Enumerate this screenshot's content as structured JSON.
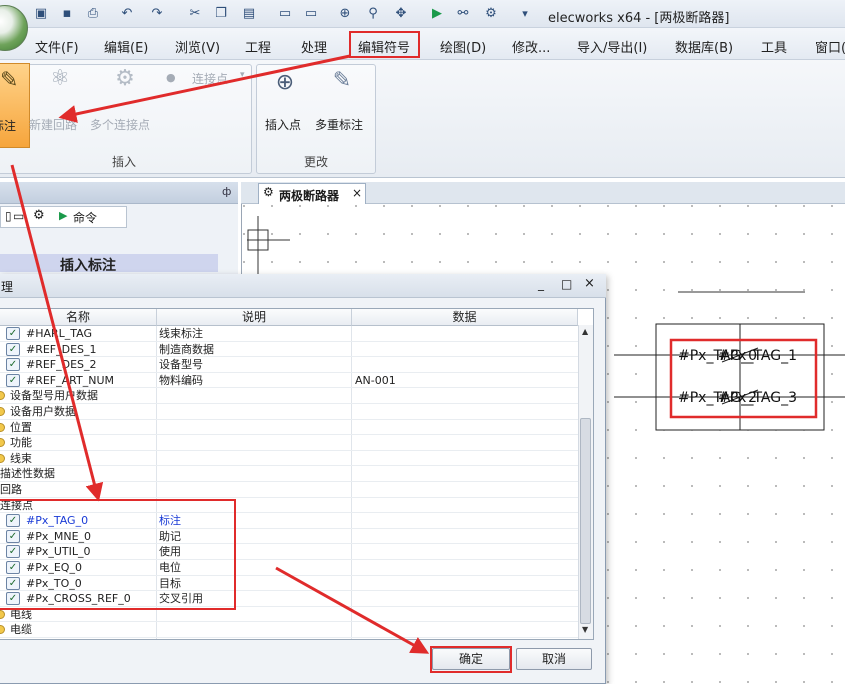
{
  "window": {
    "title": "elecworks x64 - [两极断路器]"
  },
  "menu": [
    "文件(F)",
    "编辑(E)",
    "浏览(V)",
    "工程",
    "处理",
    "编辑符号",
    "绘图(D)",
    "修改...",
    "导入/导出(I)",
    "数据库(B)",
    "工具",
    "窗口("
  ],
  "ribbon": {
    "insert_group": {
      "label": "插入",
      "buttons": [
        "标注",
        "新建回路",
        "多个连接点"
      ],
      "small_button": "连接点"
    },
    "change_group": {
      "label": "更改",
      "buttons": [
        "插入点",
        "多重标注"
      ]
    }
  },
  "left_panel": {
    "pin_glyph": "ф",
    "tab_label": "命令",
    "heading": "插入标注"
  },
  "document_tab": {
    "label": "两极断路器",
    "close": "×"
  },
  "canvas": {
    "symbol_lines": [
      "#Px_TAG_0",
      "#Px_TAG_2"
    ],
    "tag_overlays": [
      "#Px_TAG_1",
      "#Px_TAG_3"
    ]
  },
  "dialog": {
    "title": "理",
    "controls": [
      "_",
      "□",
      "×"
    ],
    "columns": [
      "名称",
      "说明",
      "数据"
    ],
    "rows": [
      {
        "name": "#HARL_TAG",
        "desc": "线束标注",
        "data": "",
        "icon": "check",
        "indent": 1
      },
      {
        "name": "#REF_DES_1",
        "desc": "制造商数据",
        "data": "",
        "icon": "check",
        "indent": 1
      },
      {
        "name": "#REF_DES_2",
        "desc": "设备型号",
        "data": "",
        "icon": "check",
        "indent": 1
      },
      {
        "name": "#REF_ART_NUM",
        "desc": "物料编码",
        "data": "AN-001",
        "icon": "check",
        "indent": 1
      },
      {
        "name": "设备型号用户数据",
        "desc": "",
        "data": "",
        "icon": "folder",
        "indent": 0
      },
      {
        "name": "设备用户数据",
        "desc": "",
        "data": "",
        "icon": "folder",
        "indent": 0
      },
      {
        "name": "位置",
        "desc": "",
        "data": "",
        "icon": "folder",
        "indent": 0
      },
      {
        "name": "功能",
        "desc": "",
        "data": "",
        "icon": "folder",
        "indent": 0
      },
      {
        "name": "线束",
        "desc": "",
        "data": "",
        "icon": "folder",
        "indent": 0
      },
      {
        "name": "描述性数据",
        "desc": "",
        "data": "",
        "icon": "none",
        "indent": 0
      },
      {
        "name": "回路",
        "desc": "",
        "data": "",
        "icon": "none",
        "indent": 0
      },
      {
        "name": "连接点",
        "desc": "",
        "data": "",
        "icon": "none",
        "indent": 0
      },
      {
        "name": "#Px_TAG_0",
        "desc": "标注",
        "data": "",
        "icon": "check",
        "indent": 1,
        "blue": true
      },
      {
        "name": "#Px_MNE_0",
        "desc": "助记",
        "data": "",
        "icon": "check",
        "indent": 1
      },
      {
        "name": "#Px_UTIL_0",
        "desc": "使用",
        "data": "",
        "icon": "check",
        "indent": 1
      },
      {
        "name": "#Px_EQ_0",
        "desc": "电位",
        "data": "",
        "icon": "check",
        "indent": 1
      },
      {
        "name": "#Px_TO_0",
        "desc": "目标",
        "data": "",
        "icon": "check",
        "indent": 1
      },
      {
        "name": "#Px_CROSS_REF_0",
        "desc": "交叉引用",
        "data": "",
        "icon": "check",
        "indent": 1
      },
      {
        "name": "电线",
        "desc": "",
        "data": "",
        "icon": "folder",
        "indent": 0
      },
      {
        "name": "电缆",
        "desc": "",
        "data": "",
        "icon": "folder",
        "indent": 0
      }
    ],
    "ok_label": "确定",
    "cancel_label": "取消"
  },
  "colors": {
    "annotation_red": "#e02b2b",
    "highlight_text_blue": "#1a3bd6"
  }
}
